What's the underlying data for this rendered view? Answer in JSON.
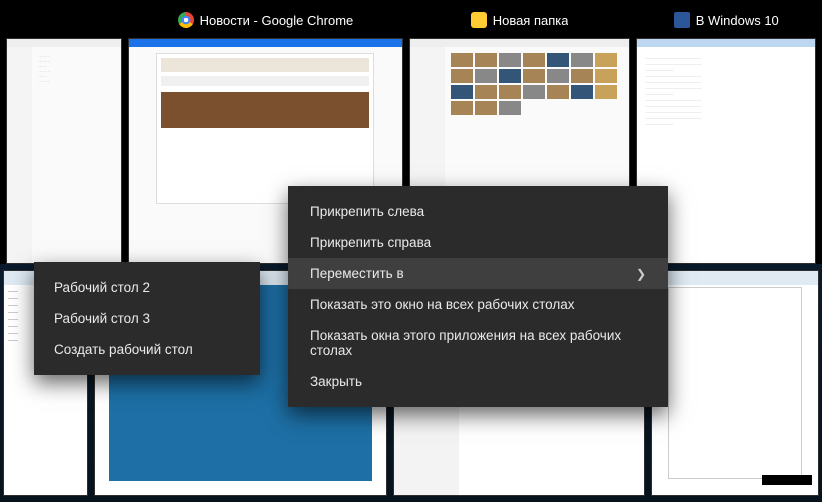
{
  "task_view": {
    "windows": [
      {
        "title": "Новости - Google Chrome",
        "icon": "chrome-icon"
      },
      {
        "title": "Новая папка",
        "icon": "folder-icon"
      },
      {
        "title": "В Windows 10",
        "icon": "word-icon"
      }
    ]
  },
  "context_menu": {
    "items": [
      {
        "label": "Прикрепить слева",
        "submenu": false
      },
      {
        "label": "Прикрепить справа",
        "submenu": false
      },
      {
        "label": "Переместить в",
        "submenu": true,
        "highlighted": true
      },
      {
        "label": "Показать это окно на всех рабочих столах",
        "submenu": false
      },
      {
        "label": "Показать окна этого приложения на всех рабочих столах",
        "submenu": false
      },
      {
        "label": "Закрыть",
        "submenu": false
      }
    ]
  },
  "desktop_submenu": {
    "items": [
      {
        "label": "Рабочий стол 2"
      },
      {
        "label": "Рабочий стол 3"
      },
      {
        "label": "Создать рабочий стол"
      }
    ]
  }
}
